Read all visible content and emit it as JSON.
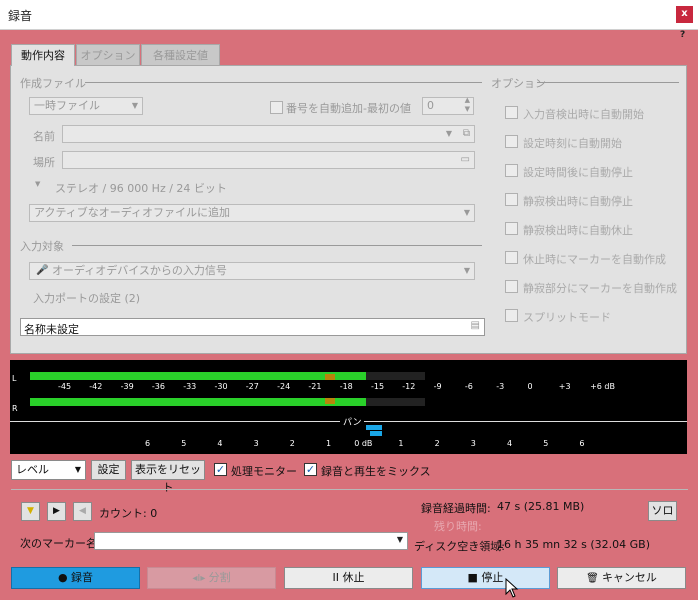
{
  "window": {
    "title": "録音",
    "close": "x",
    "help": "?"
  },
  "tabs": [
    {
      "label": "動作内容"
    },
    {
      "label": "オプション"
    },
    {
      "label": "各種設定値"
    }
  ],
  "create_file": {
    "section": "作成ファイル",
    "file_type": "一時ファイル",
    "auto_number_label": "番号を自動追加-最初の値",
    "auto_number_value": "0",
    "name_label": "名前",
    "location_label": "場所",
    "format": "ステレオ / 96 000 Hz / 24 ビット",
    "audio_file_action": "アクティブなオーディオファイルに追加"
  },
  "input": {
    "section": "入力対象",
    "source": "オーディオデバイスからの入力信号",
    "port_setting": "入力ポートの設定 (2)",
    "untitled": "名称未設定"
  },
  "options": {
    "section": "オプション",
    "items": [
      "入力音検出時に自動開始",
      "設定時刻に自動開始",
      "設定時間後に自動停止",
      "静寂検出時に自動停止",
      "静寂検出時に自動休止",
      "休止時にマーカーを自動作成",
      "静寂部分にマーカーを自動作成",
      "スプリットモード"
    ]
  },
  "meter": {
    "channel_l": "L",
    "channel_r": "R",
    "scale": [
      "-45",
      "-42",
      "-39",
      "-36",
      "-33",
      "-30",
      "-27",
      "-24",
      "-21",
      "-18",
      "-15",
      "-12",
      "-9",
      "-6",
      "-3",
      "0",
      "+3",
      "+6 dB"
    ],
    "pan_label": "パン",
    "pan_scale": [
      "6",
      "5",
      "4",
      "3",
      "2",
      "1",
      "0 dB",
      "1",
      "2",
      "3",
      "4",
      "5",
      "6"
    ],
    "level_l": 0.85,
    "level_r": 0.85
  },
  "controls": {
    "mode": "レベル",
    "settings": "設定",
    "reset": "表示をリセット",
    "monitor": "処理モニター",
    "mix": "録音と再生をミックス"
  },
  "status": {
    "count": "カウント: 0",
    "next_marker": "次のマーカー名",
    "elapsed_label": "録音経過時間:",
    "elapsed_value": "47 s (25.81 MB)",
    "remaining_label": "残り時間:",
    "disk_label": "ディスク空き領域:",
    "disk_value": "16 h 35 mn 32 s (32.04 GB)",
    "solo": "ソロ"
  },
  "buttons": {
    "record": "● 録音",
    "split": "分割",
    "pause": "II 休止",
    "stop": "■ 停止",
    "cancel": "キャンセル"
  },
  "colors": {
    "accent": "#d8707a",
    "record": "#1f9be0",
    "meter_green": "#2ad02a",
    "pan": "#1aa7e8"
  }
}
